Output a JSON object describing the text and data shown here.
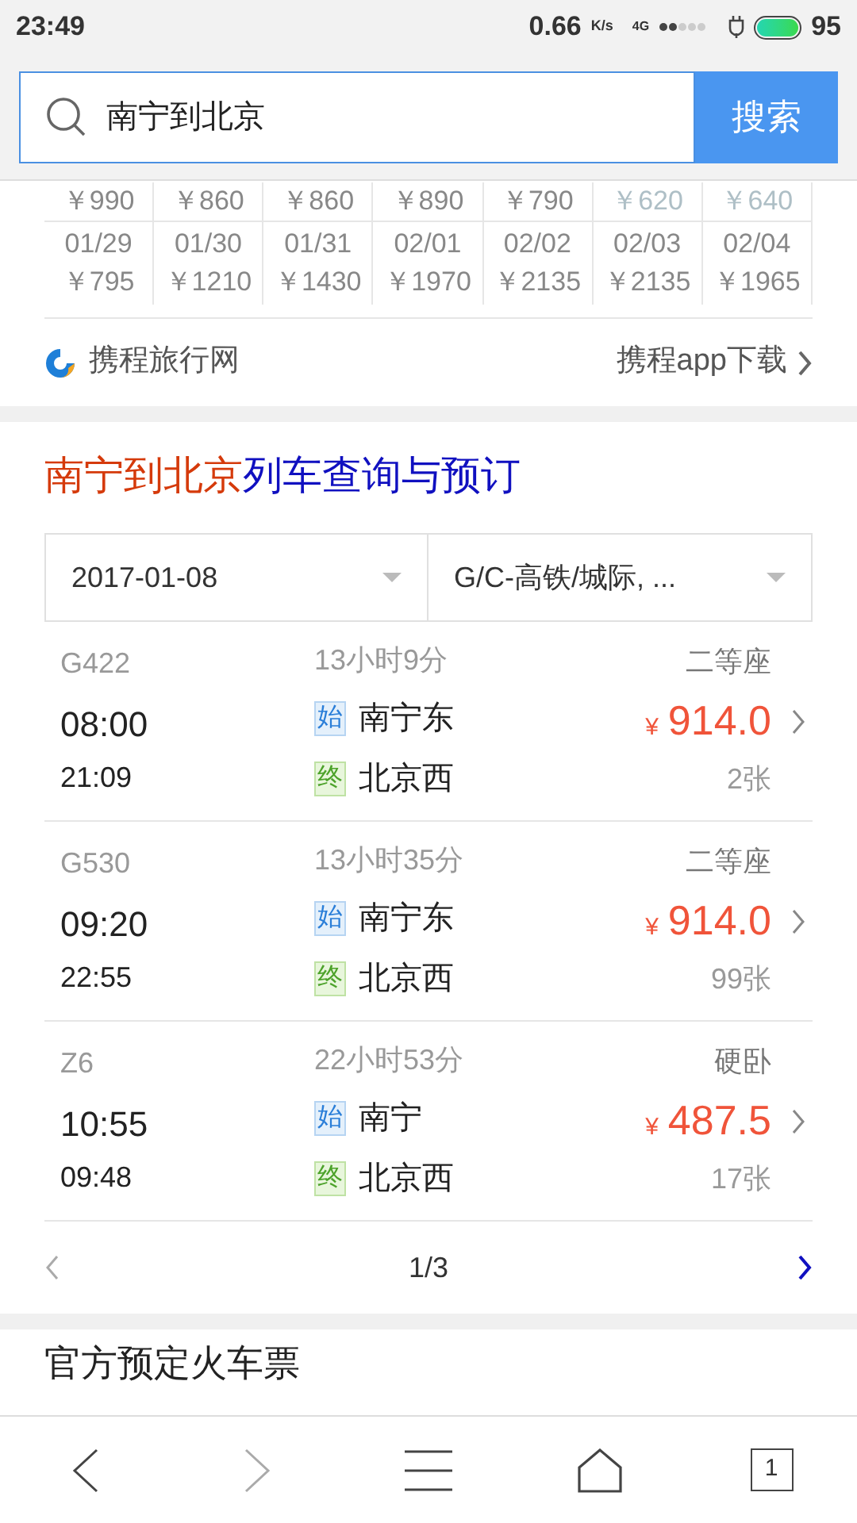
{
  "status_bar": {
    "time": "23:49",
    "speed": "0.66",
    "speed_unit": "K/s",
    "network": "4G",
    "battery": "95"
  },
  "search": {
    "value": "南宁到北京",
    "button": "搜索"
  },
  "price_calendar": [
    {
      "cells": [
        {
          "price": "￥990",
          "muted": false
        },
        {
          "price": "￥860",
          "muted": false
        },
        {
          "price": "￥860",
          "muted": false
        },
        {
          "price": "￥890",
          "muted": false
        },
        {
          "price": "￥790",
          "muted": false
        },
        {
          "price": "￥620",
          "muted": true
        },
        {
          "price": "￥640",
          "muted": true
        }
      ]
    },
    {
      "cells": [
        {
          "date": "01/29",
          "price": "￥795",
          "muted": false
        },
        {
          "date": "01/30",
          "price": "￥1210",
          "muted": false
        },
        {
          "date": "01/31",
          "price": "￥1430",
          "muted": false
        },
        {
          "date": "02/01",
          "price": "￥1970",
          "muted": false
        },
        {
          "date": "02/02",
          "price": "￥2135",
          "muted": false
        },
        {
          "date": "02/03",
          "price": "￥2135",
          "muted": false
        },
        {
          "date": "02/04",
          "price": "￥1965",
          "muted": false
        }
      ]
    }
  ],
  "brand": {
    "name": "携程旅行网",
    "link": "携程app下载"
  },
  "section": {
    "title_route": "南宁到北京",
    "title_rest": "列车查询与预订",
    "filters": [
      {
        "value": "2017-01-08"
      },
      {
        "value": "G/C-高铁/城际, ..."
      }
    ],
    "trains": [
      {
        "number": "G422",
        "depart": "08:00",
        "arrive": "21:09",
        "duration": "13小时9分",
        "from_mark": "始",
        "from_station": "南宁东",
        "to_mark": "终",
        "to_station": "北京西",
        "seat": "二等座",
        "currency": "¥",
        "price": "914.0",
        "tickets": "2张"
      },
      {
        "number": "G530",
        "depart": "09:20",
        "arrive": "22:55",
        "duration": "13小时35分",
        "from_mark": "始",
        "from_station": "南宁东",
        "to_mark": "终",
        "to_station": "北京西",
        "seat": "二等座",
        "currency": "¥",
        "price": "914.0",
        "tickets": "99张"
      },
      {
        "number": "Z6",
        "depart": "10:55",
        "arrive": "09:48",
        "duration": "22小时53分",
        "from_mark": "始",
        "from_station": "南宁",
        "to_mark": "终",
        "to_station": "北京西",
        "seat": "硬卧",
        "currency": "¥",
        "price": "487.5",
        "tickets": "17张"
      }
    ],
    "pagination": {
      "page": "1/3",
      "prev_disabled": true,
      "next_disabled": false
    }
  },
  "next_section": {
    "title": "官方预定火车票"
  },
  "bottom_nav": {
    "back_disabled": false,
    "forward_disabled": true,
    "tabs_count": "1"
  }
}
